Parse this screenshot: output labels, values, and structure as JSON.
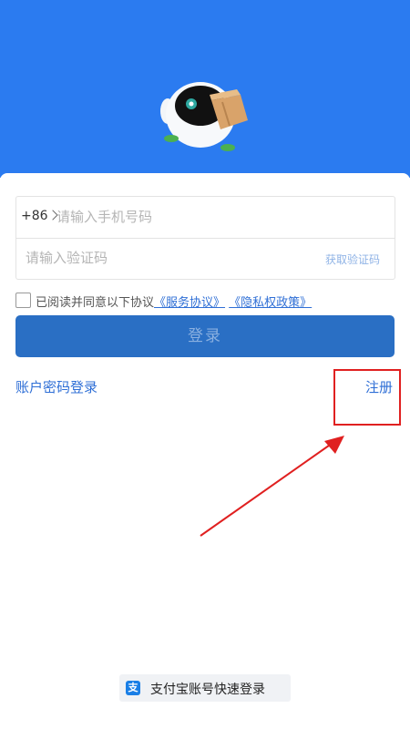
{
  "phone": {
    "country_code": "+86",
    "placeholder": "请输入手机号码"
  },
  "code": {
    "placeholder": "请输入验证码",
    "get_code_label": "获取验证码"
  },
  "agreement": {
    "prefix": "已阅读并同意以下协议",
    "service_link": "《服务协议》",
    "privacy_link": "《隐私权政策》"
  },
  "login_button": "登录",
  "password_login": "账户密码登录",
  "register": "注册",
  "quick_login": {
    "icon_char": "支",
    "label": "支付宝账号快速登录"
  },
  "colors": {
    "hero_blue": "#2b7bf0",
    "button_blue": "#2a6fc4",
    "link_blue": "#2f6fd6",
    "highlight_red": "#e02020"
  }
}
